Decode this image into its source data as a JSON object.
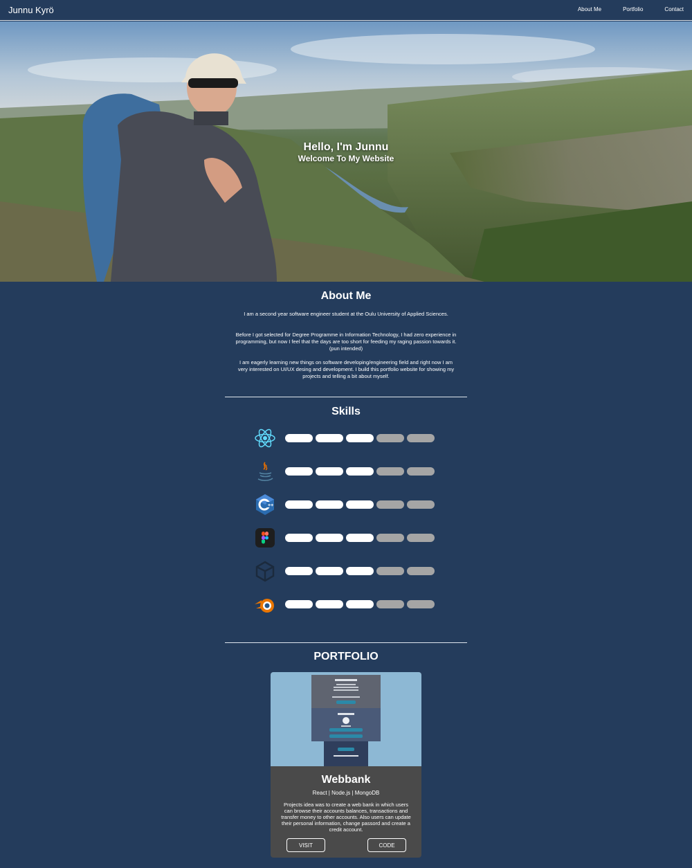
{
  "nav": {
    "brand": "Junnu Kyrö",
    "links": [
      "About Me",
      "Portfolio",
      "Contact"
    ]
  },
  "hero": {
    "title": "Hello, I'm Junnu",
    "subtitle": "Welcome To My Website"
  },
  "about": {
    "title": "About Me",
    "paragraphs": [
      "I am a second year software engineer student at the Oulu University of Applied Sciences.",
      "Before I got selected for Degree Programme in Information Technology, I had zero experience in programming, but now I feel that the days are too short for feeding my raging passion towards it. (pun intended)",
      "I am eagerly learning new things on software developing/engineering field and right now I am very interested on UI/UX desing and development. I build this portfolio website for showing my projects and telling a bit about myself."
    ]
  },
  "skills": {
    "title": "Skills",
    "max_level": 5,
    "items": [
      {
        "icon": "react-icon",
        "level": 3
      },
      {
        "icon": "java-icon",
        "level": 3
      },
      {
        "icon": "csharp-icon",
        "level": 3
      },
      {
        "icon": "figma-icon",
        "level": 3
      },
      {
        "icon": "unity-icon",
        "level": 3
      },
      {
        "icon": "blender-icon",
        "level": 3
      }
    ]
  },
  "portfolio": {
    "title": "PORTFOLIO",
    "projects": [
      {
        "name": "Webbank",
        "tech": [
          "React",
          "Node.js",
          "MongoDB"
        ],
        "description": "Projects idea was to create a web bank in which users can browse their accounts balances, transactions and transfer money to other accounts. Also users can update their personal information, change passord and create a credit account.",
        "visit_label": "VISIT",
        "code_label": "CODE"
      }
    ]
  },
  "colors": {
    "background": "#243c5c",
    "bar_on": "#ffffff",
    "bar_off": "#a5a5a5",
    "card": "#4a4a4a",
    "card_preview": "#8db8d4"
  }
}
